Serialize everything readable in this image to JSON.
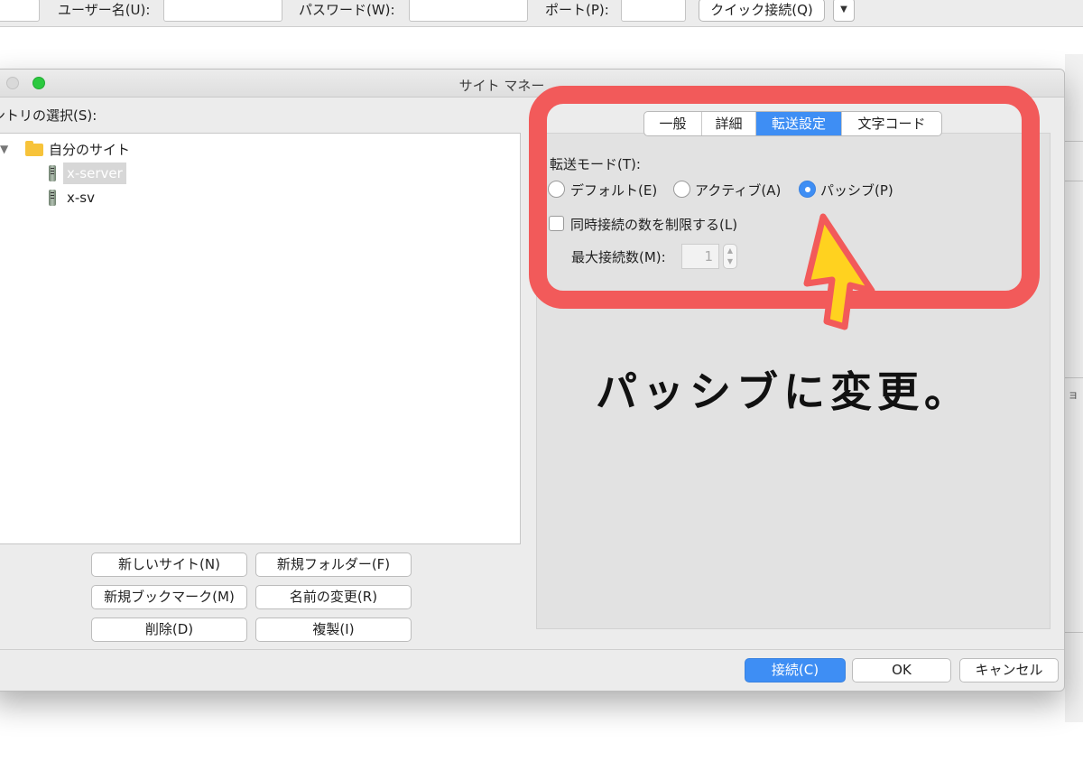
{
  "quickconnect": {
    "username_label": "ユーザー名(U):",
    "password_label": "パスワード(W):",
    "port_label": "ポート(P):",
    "connect_button": "クイック接続(Q)",
    "dropdown_arrow": "▼"
  },
  "background_edge_text": "ョ",
  "dialog": {
    "title": "サイト マネー",
    "entry_label": "ントリの選択(S):",
    "tree": {
      "disclosure": "▼",
      "folder": {
        "label": "自分のサイト",
        "icon": "folder-icon"
      },
      "sites": [
        {
          "label": "x-server",
          "icon": "server-icon",
          "selected": true
        },
        {
          "label": "x-sv",
          "icon": "server-icon",
          "selected": false
        }
      ]
    },
    "buttons": {
      "new_site": "新しいサイト(N)",
      "new_folder": "新規フォルダー(F)",
      "new_bookmark": "新規ブックマーク(M)",
      "rename": "名前の変更(R)",
      "delete": "削除(D)",
      "duplicate": "複製(I)"
    },
    "tabs": [
      {
        "label": "一般",
        "active": false
      },
      {
        "label": "詳細",
        "active": false
      },
      {
        "label": "転送設定",
        "active": true
      },
      {
        "label": "文字コード",
        "active": false
      }
    ],
    "transfer": {
      "mode_label": "転送モード(T):",
      "modes": [
        {
          "label": "デフォルト(E)",
          "selected": false
        },
        {
          "label": "アクティブ(A)",
          "selected": false
        },
        {
          "label": "パッシブ(P)",
          "selected": true
        }
      ],
      "limit_label": "同時接続の数を制限する(L)",
      "limit_checked": false,
      "max_label": "最大接続数(M):",
      "max_value": "1"
    },
    "footer": {
      "connect": "接続(C)",
      "ok": "OK",
      "cancel": "キャンセル"
    }
  },
  "annotation": {
    "caption": "パッシブに変更。",
    "highlight_color": "#f25a5a",
    "arrow_color": "#ffd21f"
  },
  "colors": {
    "accent": "#3e8ef4"
  }
}
